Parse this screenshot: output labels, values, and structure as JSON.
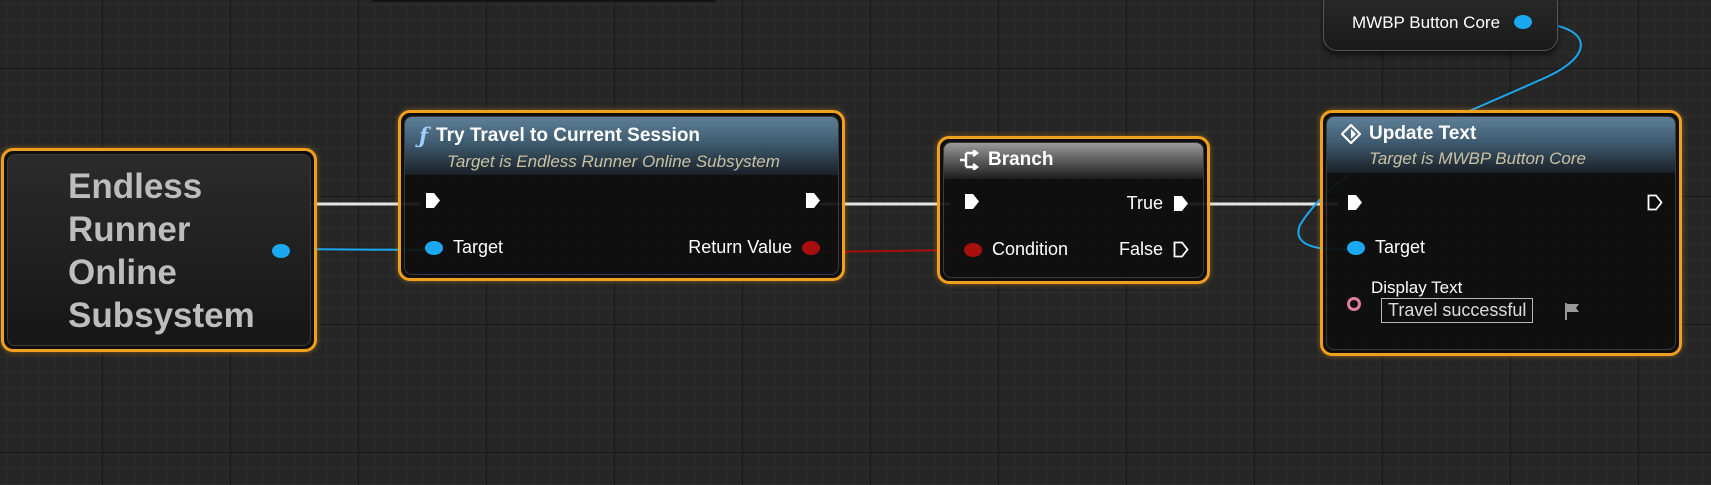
{
  "nodes": {
    "subsystem": {
      "title_line1": "Endless",
      "title_line2": "Runner",
      "title_line3": "Online",
      "title_line4": "Subsystem"
    },
    "try_travel": {
      "title": "Try Travel to Current Session",
      "subtitle": "Target is Endless Runner Online Subsystem",
      "pin_target": "Target",
      "pin_return": "Return Value"
    },
    "branch": {
      "title": "Branch",
      "pin_condition": "Condition",
      "pin_true": "True",
      "pin_false": "False"
    },
    "update_text": {
      "title": "Update Text",
      "subtitle": "Target is MWBP Button Core",
      "pin_target": "Target",
      "pin_display_text": "Display Text",
      "display_text_value": "Travel successful"
    },
    "variable": {
      "label": "MWBP Button Core"
    }
  },
  "colors": {
    "selection": "#f0a01c",
    "object_pin": "#1aa9f0",
    "bool_pin": "#a80e0e",
    "text_pin": "#e17ea4",
    "exec_pin": "#ffffff"
  }
}
